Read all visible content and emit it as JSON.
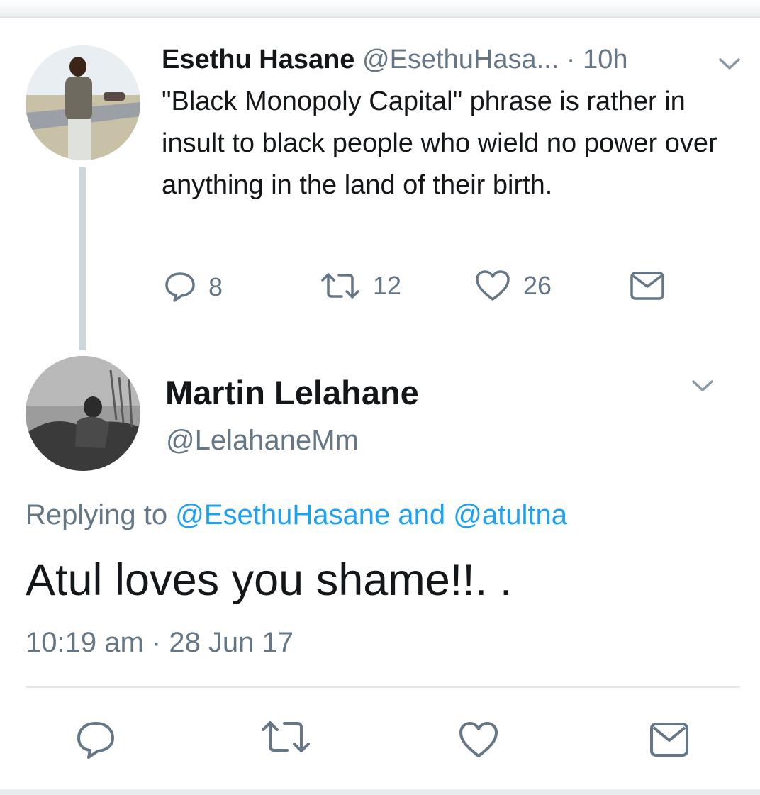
{
  "tweet1": {
    "name": "Esethu Hasane",
    "handle": "@EsethuHasa...",
    "dot": "·",
    "time": "10h",
    "text": "\"Black Monopoly Capital\" phrase is rather in insult to black people who wield no power over anything in the land of their birth.",
    "replies": "8",
    "retweets": "12",
    "likes": "26",
    "avatar_icon": "profile-photo-man-standing-road",
    "menu_icon": "chevron-down-icon"
  },
  "tweet2": {
    "name": "Martin Lelahane",
    "handle": "@LelahaneMm",
    "replying_prefix": "Replying to",
    "replying_user1": "@EsethuHasane",
    "replying_and": "and",
    "replying_user2": "@atultna",
    "text": "Atul loves you shame!!. .",
    "timestamp": "10:19 am · 28 Jun 17",
    "avatar_icon": "profile-photo-grayscale-man",
    "menu_icon": "chevron-down-icon"
  },
  "colors": {
    "text": "#14171a",
    "secondary": "#657786",
    "link": "#1da1f2",
    "thread_line": "#ccd6dd",
    "divider": "#e1e8ed"
  }
}
